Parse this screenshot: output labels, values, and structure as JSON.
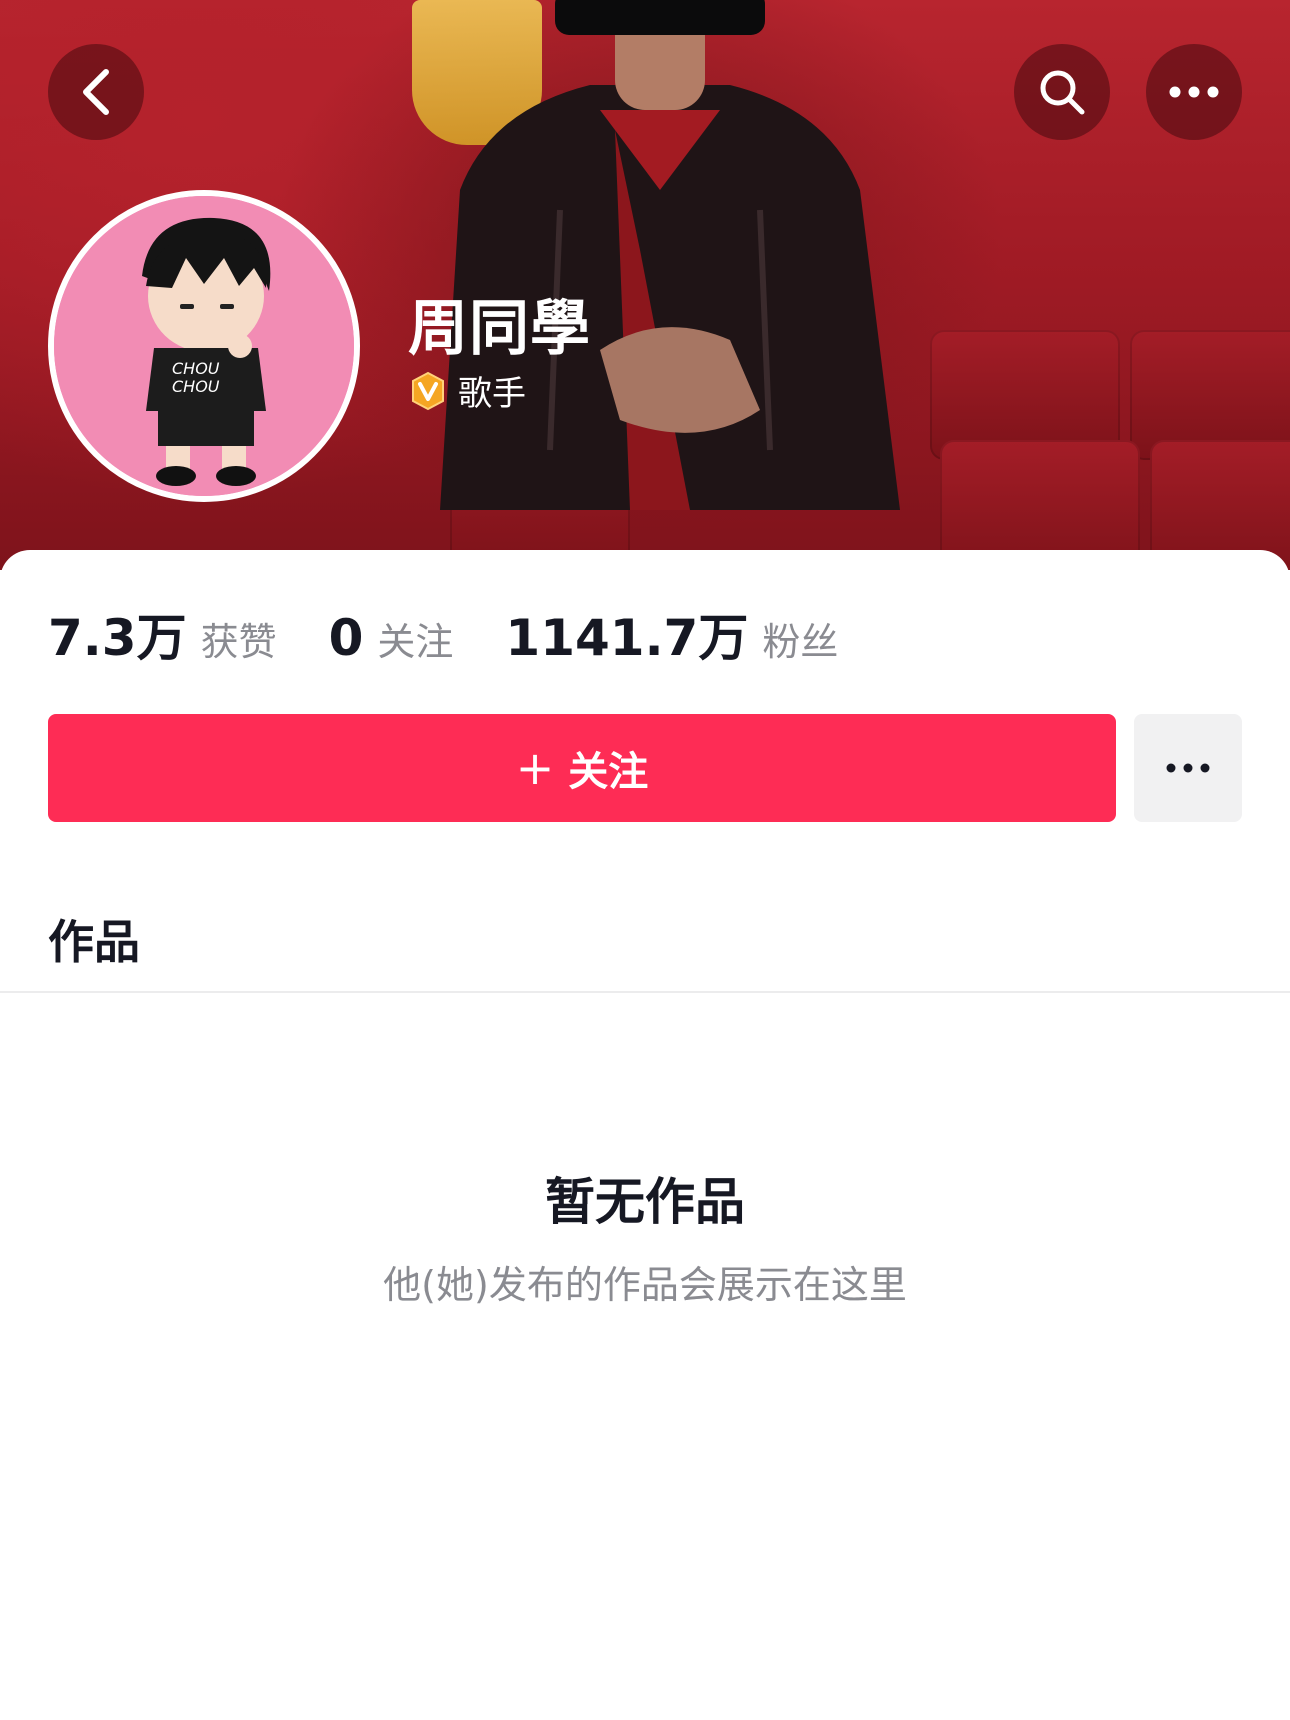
{
  "header": {
    "back_icon": "chevron-left-icon",
    "search_icon": "search-icon",
    "more_icon": "ellipsis-horizontal-icon"
  },
  "profile": {
    "display_name": "周同學",
    "verification_icon": "verified-v-badge-icon",
    "verification_label": "歌手",
    "avatar_description": "cartoon figure avatar on pink background"
  },
  "stats": [
    {
      "value": "7.3万",
      "label": "获赞"
    },
    {
      "value": "0",
      "label": "关注"
    },
    {
      "value": "1141.7万",
      "label": "粉丝"
    }
  ],
  "actions": {
    "follow_prefix": "+",
    "follow_label": "关注",
    "more_icon": "ellipsis-horizontal-icon"
  },
  "tabs": {
    "works_label": "作品"
  },
  "empty_state": {
    "title": "暂无作品",
    "subtitle": "他(她)发布的作品会展示在这里"
  },
  "colors": {
    "accent": "#fe2c55",
    "hero_red": "#b8252f",
    "text_primary": "#161823",
    "text_secondary": "#8a8b91",
    "badge_gold": "#f5a623"
  }
}
